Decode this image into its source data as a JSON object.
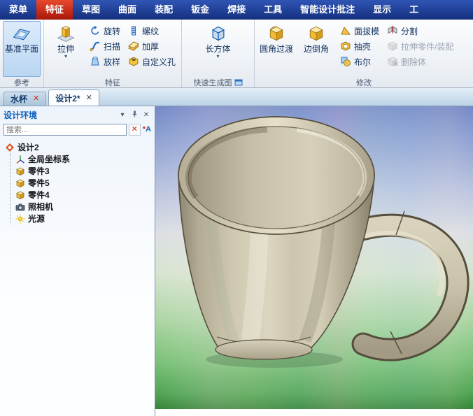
{
  "menubar": {
    "items": [
      "菜单",
      "特征",
      "草图",
      "曲面",
      "装配",
      "钣金",
      "焊接",
      "工具",
      "智能设计批注",
      "显示",
      "工"
    ],
    "active": "特征"
  },
  "ribbon": {
    "reference": {
      "caption": "参考",
      "datum_plane": "基准平面"
    },
    "feature": {
      "caption": "特征",
      "extrude": "拉伸",
      "revolve": "旋转",
      "sweep": "扫描",
      "loft": "放样",
      "thread": "螺纹",
      "thicken": "加厚",
      "custom_hole": "自定义孔"
    },
    "quick": {
      "caption": "快速生成图",
      "box": "长方体"
    },
    "modify": {
      "caption": "修改",
      "fillet": "圆角过渡",
      "chamfer": "边倒角",
      "draft": "面拔模",
      "shell": "抽壳",
      "boolean": "布尔",
      "split": "分割",
      "stretch_part": "拉伸零件/装配",
      "delete_body": "删除体"
    }
  },
  "doc_tabs": {
    "tab1": "水杯",
    "tab2": "设计2*"
  },
  "panel": {
    "title": "设计环境",
    "search_placeholder": "搜索...",
    "tree": {
      "root": "设计2",
      "items": [
        "全局坐标系",
        "零件3",
        "零件5",
        "零件4",
        "照相机",
        "光源"
      ]
    }
  },
  "viewport": {
    "content": "3d-mug-model"
  },
  "colors": {
    "menubar": "#16307c",
    "menu_active": "#c2180b",
    "ribbon_selection": "#cfe4f7",
    "viewport_bg_top": "#7488c6",
    "viewport_bg_bottom": "#358436",
    "mug": "#cfc8b2"
  }
}
